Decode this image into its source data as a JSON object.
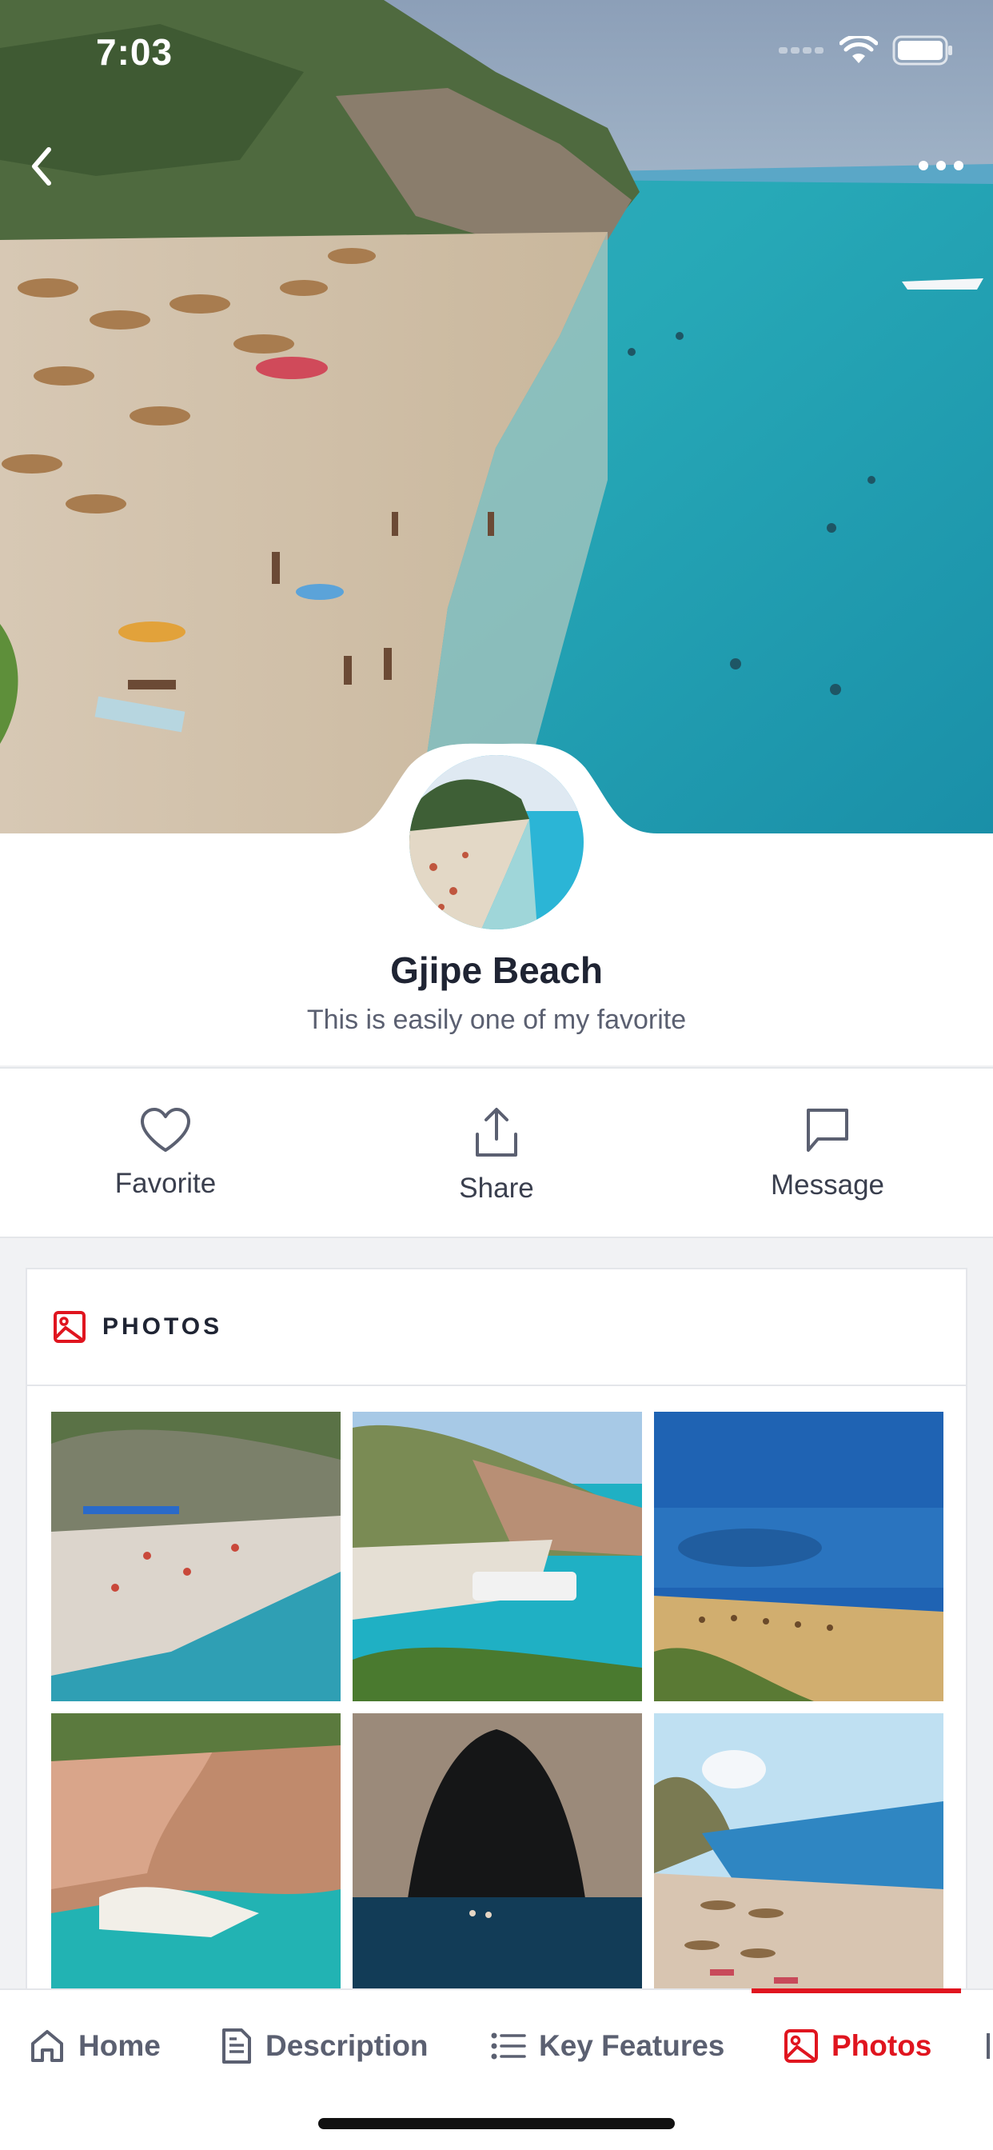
{
  "status_bar": {
    "time": "7:03"
  },
  "nav": {
    "back_icon": "chevron-left-icon",
    "more_icon": "ellipsis-icon"
  },
  "profile": {
    "title": "Gjipe Beach",
    "subtitle": "This is easily one of my favorite"
  },
  "actions": [
    {
      "label": "Favorite",
      "icon": "heart-icon"
    },
    {
      "label": "Share",
      "icon": "share-icon"
    },
    {
      "label": "Message",
      "icon": "message-icon"
    }
  ],
  "photos_section": {
    "title": "PHOTOS",
    "icon": "image-icon"
  },
  "tabs": [
    {
      "label": "Home",
      "icon": "home-icon",
      "active": false
    },
    {
      "label": "Description",
      "icon": "document-icon",
      "active": false
    },
    {
      "label": "Key Features",
      "icon": "list-icon",
      "active": false
    },
    {
      "label": "Photos",
      "icon": "image-icon",
      "active": true
    }
  ],
  "colors": {
    "accent": "#e0151f",
    "text": "#1f2433",
    "muted": "#5b6071",
    "background": "#f1f2f4"
  }
}
